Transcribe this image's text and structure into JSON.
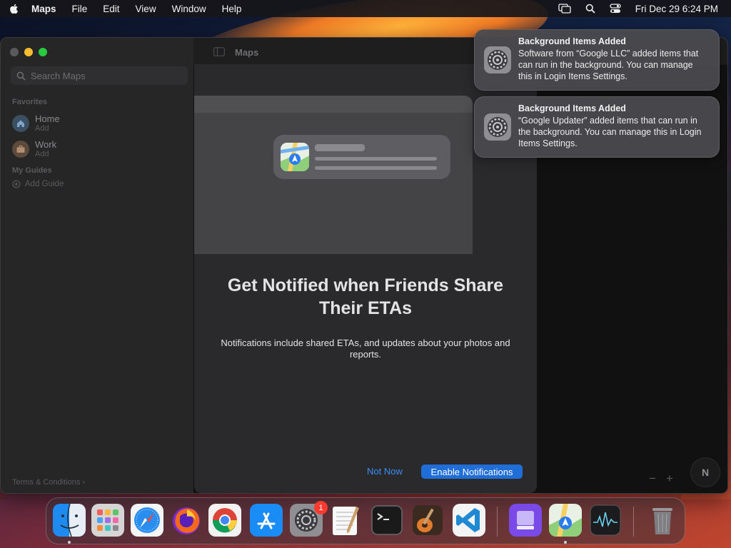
{
  "menubar": {
    "app_name": "Maps",
    "menus": [
      "File",
      "Edit",
      "View",
      "Window",
      "Help"
    ],
    "clock": "Fri Dec 29  6:24 PM"
  },
  "window": {
    "title": "Maps",
    "sidebar": {
      "search_placeholder": "Search Maps",
      "favorites_label": "Favorites",
      "favorites": [
        {
          "title": "Home",
          "subtitle": "Add",
          "icon": "house-icon"
        },
        {
          "title": "Work",
          "subtitle": "Add",
          "icon": "briefcase-icon"
        }
      ],
      "guides_label": "My Guides",
      "add_guide": "Add Guide",
      "terms": "Terms & Conditions ›"
    },
    "map": {
      "zoom_out": "−",
      "zoom_in": "+",
      "compass": "N"
    }
  },
  "sheet": {
    "heading": "Get Notified when Friends Share Their ETAs",
    "body": "Notifications include shared ETAs, and updates about your photos and reports.",
    "not_now": "Not Now",
    "enable": "Enable Notifications"
  },
  "notifications": [
    {
      "title": "Background Items Added",
      "body": "Software from “Google LLC” added items that can run in the background. You can manage this in Login Items Settings.",
      "icon": "system-settings-icon"
    },
    {
      "title": "Background Items Added",
      "body": "“Google Updater” added items that can run in the background. You can manage this in Login Items Settings.",
      "icon": "system-settings-icon"
    }
  ],
  "dock": {
    "apps": [
      "Finder",
      "Launchpad",
      "Safari",
      "Firefox",
      "Chrome",
      "App Store",
      "System Settings",
      "TextEdit",
      "Terminal",
      "GarageBand",
      "Visual Studio Code",
      "Disk Utility",
      "Maps",
      "Activity Monitor",
      "Trash"
    ],
    "settings_badge": "1"
  },
  "colors": {
    "accent": "#1f6ed8",
    "link": "#3a8ef6",
    "badge": "#ff3b30"
  }
}
